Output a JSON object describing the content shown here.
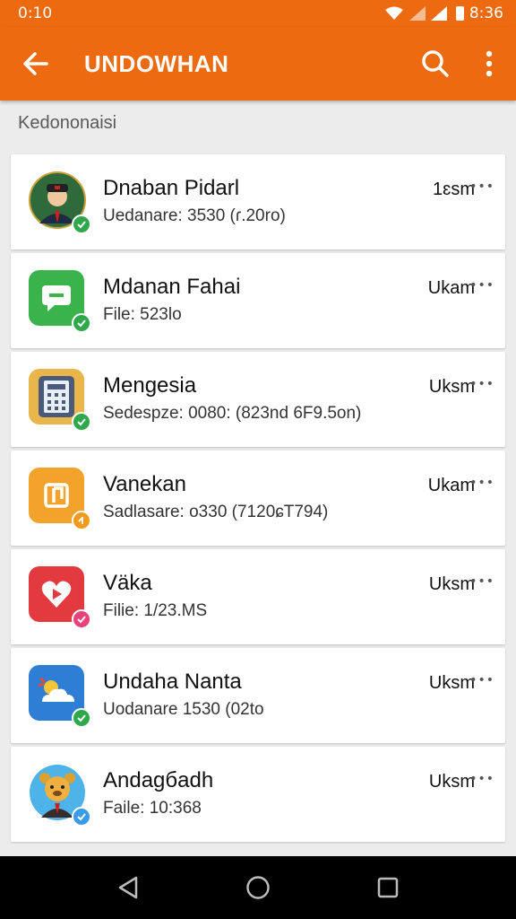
{
  "status_bar": {
    "left_time": "0:10",
    "right_time": "8:36"
  },
  "app_bar": {
    "title": "UNDOWHAN"
  },
  "section": {
    "label": "Kedononaisi"
  },
  "items": [
    {
      "name": "Dnaban Pidarl",
      "detail": "Uedanare: 3530 (ɾ.20ro)",
      "time": "1ɛsm",
      "more": "•••",
      "icon": "person-avatar-icon",
      "icon_color": "#2f6b3a",
      "badge_color": "#2ea84a"
    },
    {
      "name": "Mdanan Fahai",
      "detail": "File: 523lo",
      "time": "Ukam",
      "more": "•••",
      "icon": "message-icon",
      "icon_color": "#3bb34b",
      "badge_color": "#2ea84a"
    },
    {
      "name": "Mengesia",
      "detail": "Sedespze: 0080: (823nd 6F9.5on)",
      "time": "Uksm",
      "more": "•••",
      "icon": "calculator-icon",
      "icon_color": "#e8b64a",
      "badge_color": "#2ea84a"
    },
    {
      "name": "Vanekan",
      "detail": "Sadlasare: o330 (7120ɕT794)",
      "time": "Ukam",
      "more": "•••",
      "icon": "music-note-icon",
      "icon_color": "#f3a22c",
      "badge_color": "#f39a1c"
    },
    {
      "name": "Väka",
      "detail": "Filie: 1/23.MS",
      "time": "Uksm",
      "more": "•••",
      "icon": "play-heart-icon",
      "icon_color": "#e23a3f",
      "badge_color": "#e8427a"
    },
    {
      "name": "Undaha Nanta",
      "detail": "Uodanare 1530 (02to",
      "time": "Uksm",
      "more": "•••",
      "icon": "weather-icon",
      "icon_color": "#2f7ed6",
      "badge_color": "#2ea84a"
    },
    {
      "name": "Andaɡбadh",
      "detail": "Faile: 10:368",
      "time": "Uksm",
      "more": "•••",
      "icon": "bear-avatar-icon",
      "icon_color": "#4eb3e8",
      "badge_color": "#3a9be8"
    }
  ]
}
